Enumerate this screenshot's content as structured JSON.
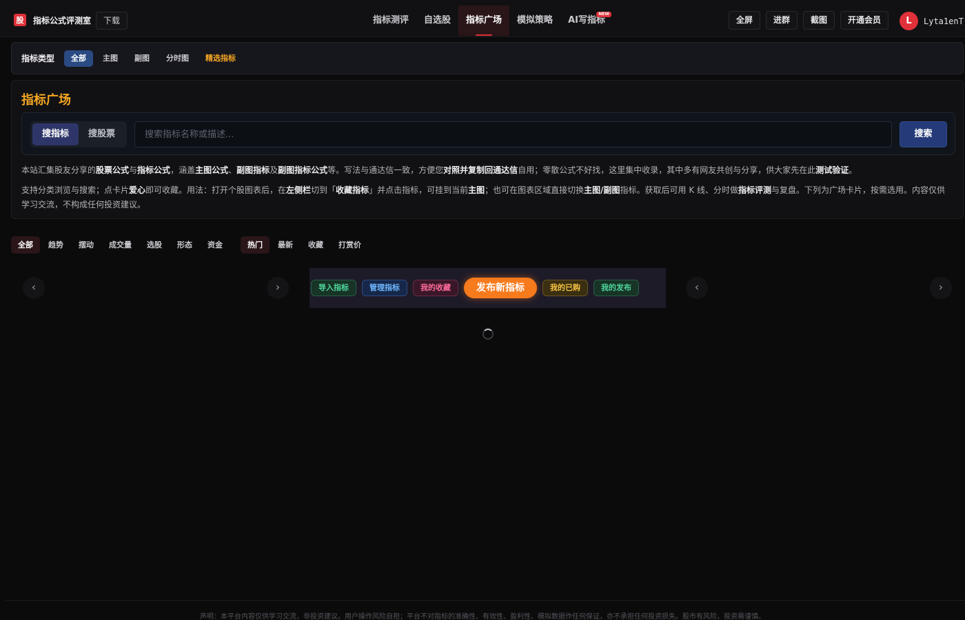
{
  "brand": {
    "logo": "股",
    "title": "指标公式评测室",
    "download": "下载"
  },
  "nav": {
    "items": [
      {
        "label": "指标测评"
      },
      {
        "label": "自选股"
      },
      {
        "label": "指标广场"
      },
      {
        "label": "模拟策略"
      },
      {
        "label": "AI写指标",
        "badge": "NEW"
      }
    ],
    "active_index": 2
  },
  "toolbar": {
    "fullscreen": "全屏",
    "group": "进群",
    "screenshot": "截图",
    "vip": "开通会员"
  },
  "user": {
    "avatar_letter": "L",
    "name": "Lyta1enT"
  },
  "type_bar": {
    "label": "指标类型",
    "tabs": [
      "全部",
      "主图",
      "副图",
      "分时图",
      "精选指标"
    ],
    "active_index": 0
  },
  "square": {
    "title": "指标广场",
    "modes": [
      "搜指标",
      "搜股票"
    ],
    "active_mode": 0,
    "search_placeholder": "搜索指标名称或描述...",
    "search_button": "搜索",
    "desc1": {
      "t1": "本站汇集股友分享的",
      "b1": "股票公式",
      "t2": "与",
      "b2": "指标公式",
      "t3": "，涵盖",
      "b3": "主图公式",
      "t4": "、",
      "b4": "副图指标",
      "t5": "及",
      "b5": "副图指标公式",
      "t6": "等。写法与通达信一致，方便您",
      "b6": "对照并复制回通达信",
      "t7": "自用；零散公式不好找，这里集中收录，其中多有网友共创与分享，供大家先在此",
      "b7": "测试验证",
      "t8": "。"
    },
    "desc2": {
      "t1": "支持分类浏览与搜索；点卡片",
      "b1": "爱心",
      "t2": "即可收藏。用法：打开个股图表后，在",
      "b2": "左侧栏",
      "t3": "切到「",
      "b3": "收藏指标",
      "t4": "」并点击指标，可挂到当前",
      "b4": "主图",
      "t5": "；也可在图表区域直接切换",
      "b5": "主图/副图",
      "t6": "指标。获取后可用 K 线、分时做",
      "b6": "指标评测",
      "t7": "与复盘。下列为广场卡片，按需选用。内容仅供学习交流，不构成任何投资建议。"
    }
  },
  "filters": {
    "categories": [
      "全部",
      "趋势",
      "摆动",
      "成交量",
      "选股",
      "形态",
      "资金"
    ],
    "active_category": 0,
    "sorts": [
      "热门",
      "最新",
      "收藏",
      "打赏价"
    ],
    "active_sort": 0
  },
  "actions": {
    "import": "导入指标",
    "manage": "管理指标",
    "favorites": "我的收藏",
    "publish": "发布新指标",
    "purchased": "我的已购",
    "published": "我的发布"
  },
  "arrows": {
    "left": "‹",
    "right": "›"
  },
  "footer": {
    "disclaimer": "声明：本平台内容仅供学习交流，非投资建议。用户操作风险自担；平台不对指标的准确性、有效性、盈利性、模拟数据作任何保证，亦不承担任何投资损失。股市有风险，投资需谨慎。"
  },
  "colors": {
    "accent_red": "#e0313a",
    "accent_orange": "#f5a623",
    "publish_orange": "#f77a1c"
  }
}
